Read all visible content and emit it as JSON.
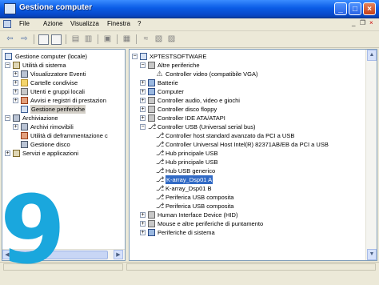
{
  "window": {
    "title": "Gestione computer",
    "controls": [
      "minimize-icon",
      "maximize-icon",
      "close-icon"
    ]
  },
  "menu": {
    "items": [
      "File",
      "Azione",
      "Visualizza",
      "Finestra",
      "?"
    ],
    "doc_controls": [
      "_",
      "❐",
      "×"
    ]
  },
  "toolbar": {
    "buttons": [
      "back-icon",
      "forward-icon",
      "up-icon",
      "show-tree-icon",
      "properties-icon",
      "print-icon",
      "help-icon",
      "scan-icon",
      "uninstall-icon",
      "disable-icon",
      "update-driver-icon"
    ]
  },
  "left_tree": [
    {
      "label": "Gestione computer (locale)",
      "icon": "computer-management-icon",
      "level": 0,
      "expander": ""
    },
    {
      "label": "Utilità di sistema",
      "icon": "tools-icon",
      "level": 1,
      "expander": "−"
    },
    {
      "label": "Visualizzatore Eventi",
      "icon": "event-viewer-icon",
      "level": 2,
      "expander": "+"
    },
    {
      "label": "Cartelle condivise",
      "icon": "shared-folder-icon",
      "level": 2,
      "expander": "+"
    },
    {
      "label": "Utenti e gruppi locali",
      "icon": "users-icon",
      "level": 2,
      "expander": "+"
    },
    {
      "label": "Avvisi e registri di prestazion",
      "icon": "performance-icon",
      "level": 2,
      "expander": "+"
    },
    {
      "label": "Gestione periferiche",
      "icon": "device-manager-icon",
      "level": 2,
      "expander": "",
      "selected": true
    },
    {
      "label": "Archiviazione",
      "icon": "storage-icon",
      "level": 1,
      "expander": "−"
    },
    {
      "label": "Archivi rimovibili",
      "icon": "removable-storage-icon",
      "level": 2,
      "expander": "+"
    },
    {
      "label": "Utilità di deframmentazione c",
      "icon": "defrag-icon",
      "level": 2,
      "expander": ""
    },
    {
      "label": "Gestione disco",
      "icon": "disk-management-icon",
      "level": 2,
      "expander": ""
    },
    {
      "label": "Servizi e applicazioni",
      "icon": "services-icon",
      "level": 1,
      "expander": "+"
    }
  ],
  "right_tree": [
    {
      "label": "XPTESTSOFTWARE",
      "icon": "computer-icon",
      "level": 0,
      "expander": "−"
    },
    {
      "label": "Altre periferiche",
      "icon": "unknown-device-icon",
      "level": 1,
      "expander": "−"
    },
    {
      "label": "Controller video (compatibile VGA)",
      "icon": "video-controller-icon",
      "level": 2,
      "expander": ""
    },
    {
      "label": "Batterie",
      "icon": "battery-icon",
      "level": 1,
      "expander": "+"
    },
    {
      "label": "Computer",
      "icon": "computer-icon",
      "level": 1,
      "expander": "+"
    },
    {
      "label": "Controller audio, video e giochi",
      "icon": "audio-icon",
      "level": 1,
      "expander": "+"
    },
    {
      "label": "Controller disco floppy",
      "icon": "floppy-controller-icon",
      "level": 1,
      "expander": "+"
    },
    {
      "label": "Controller IDE ATA/ATAPI",
      "icon": "ide-controller-icon",
      "level": 1,
      "expander": "+"
    },
    {
      "label": "Controller USB (Universal serial bus)",
      "icon": "usb-icon",
      "level": 1,
      "expander": "−"
    },
    {
      "label": "Controller host standard avanzato da PCI a USB",
      "icon": "usb-icon",
      "level": 2,
      "expander": ""
    },
    {
      "label": "Controller Universal Host Intel(R) 82371AB/EB da PCI a USB",
      "icon": "usb-icon",
      "level": 2,
      "expander": ""
    },
    {
      "label": "Hub principale USB",
      "icon": "usb-icon",
      "level": 2,
      "expander": ""
    },
    {
      "label": "Hub principale USB",
      "icon": "usb-icon",
      "level": 2,
      "expander": ""
    },
    {
      "label": "Hub USB generico",
      "icon": "usb-icon",
      "level": 2,
      "expander": ""
    },
    {
      "label": "K-array_Dsp01 A",
      "icon": "usb-icon",
      "level": 2,
      "expander": "",
      "selected": true
    },
    {
      "label": "K-array_Dsp01 B",
      "icon": "usb-icon",
      "level": 2,
      "expander": ""
    },
    {
      "label": "Periferica USB composita",
      "icon": "usb-icon",
      "level": 2,
      "expander": ""
    },
    {
      "label": "Periferica USB composita",
      "icon": "usb-icon",
      "level": 2,
      "expander": ""
    },
    {
      "label": "Human Interface Device (HID)",
      "icon": "hid-icon",
      "level": 1,
      "expander": "+"
    },
    {
      "label": "Mouse e altre periferiche di puntamento",
      "icon": "mouse-icon",
      "level": 1,
      "expander": "+"
    },
    {
      "label": "Periferiche di sistema",
      "icon": "system-devices-icon",
      "level": 1,
      "expander": "+"
    }
  ],
  "overlay": {
    "step_number": "9",
    "color": "#1AA7DD"
  },
  "colors": {
    "title_bar": "#0A5CE6",
    "selection": "#316AC5",
    "window_bg": "#ECE9D8"
  }
}
